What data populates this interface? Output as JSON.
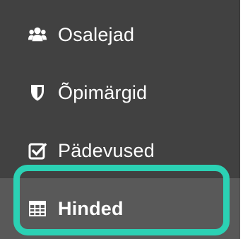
{
  "sidebar": {
    "items": [
      {
        "label": "Osalejad",
        "icon": "users-icon",
        "active": false
      },
      {
        "label": "Õpimärgid",
        "icon": "shield-icon",
        "active": false
      },
      {
        "label": "Pädevused",
        "icon": "checkbox-icon",
        "active": false
      },
      {
        "label": "Hinded",
        "icon": "table-icon",
        "active": true
      }
    ]
  },
  "colors": {
    "sidebar_background": "#414141",
    "active_background": "#595959",
    "highlight_ring": "#2bd1b4",
    "text": "#ffffff"
  }
}
